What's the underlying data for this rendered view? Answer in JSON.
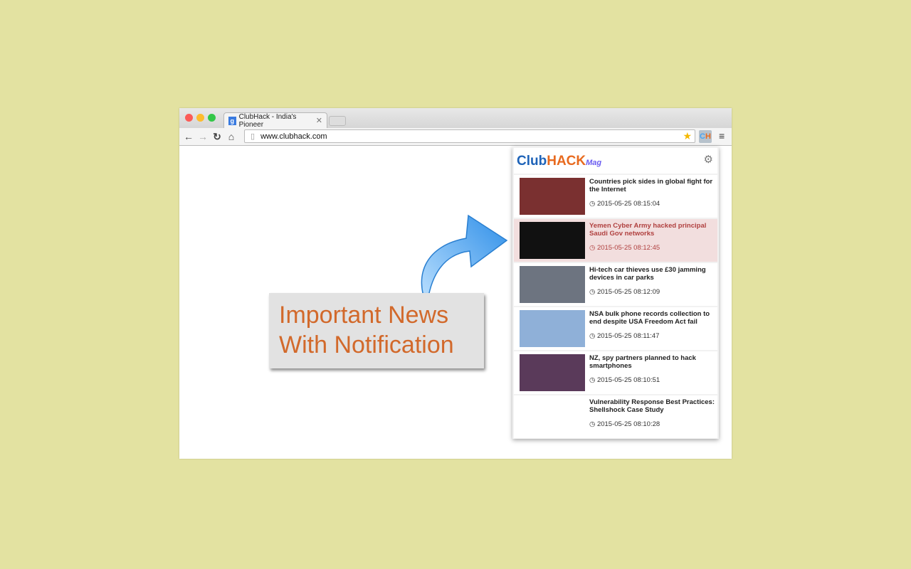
{
  "browser": {
    "tab_title": "ClubHack - India's Pioneer",
    "url": "www.clubhack.com",
    "extension_label": "CH"
  },
  "popup": {
    "logo": {
      "club": "Club",
      "hack": "HACK",
      "mag": "Mag"
    },
    "items": [
      {
        "title": "Countries pick sides in global fight for the Internet",
        "time": "2015-05-25 08:15:04",
        "highlighted": false,
        "thumb": "#7a3030"
      },
      {
        "title": "Yemen Cyber Army hacked principal Saudi Gov networks",
        "time": "2015-05-25 08:12:45",
        "highlighted": true,
        "thumb": "#111111"
      },
      {
        "title": "Hi-tech car thieves use £30 jamming devices in car parks",
        "time": "2015-05-25 08:12:09",
        "highlighted": false,
        "thumb": "#6d7480"
      },
      {
        "title": "NSA bulk phone records collection to end despite USA Freedom Act fail",
        "time": "2015-05-25 08:11:47",
        "highlighted": false,
        "thumb": "#8fb0d8"
      },
      {
        "title": "NZ, spy partners planned to hack smartphones",
        "time": "2015-05-25 08:10:51",
        "highlighted": false,
        "thumb": "#5a3a5a"
      },
      {
        "title": "Vulnerability Response Best Practices: Shellshock Case Study",
        "time": "2015-05-25 08:10:28",
        "highlighted": false,
        "thumb": "#ffffff"
      }
    ]
  },
  "callout": {
    "line1": "Important News",
    "line2": "With Notification"
  },
  "colors": {
    "background": "#e3e2a1",
    "callout_text": "#d2692b",
    "highlight": "#f2dede",
    "arrow": "#4aa3f0"
  }
}
